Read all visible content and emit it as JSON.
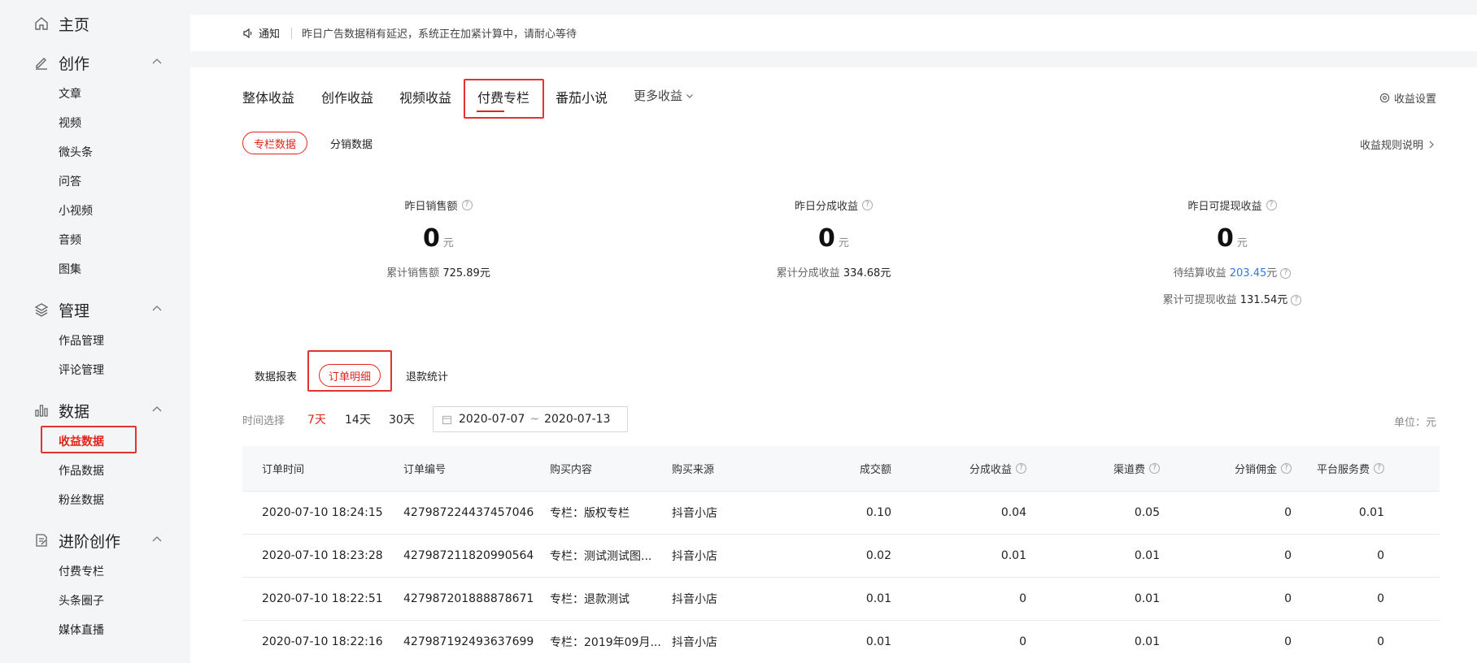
{
  "sidebar": {
    "home": "主页",
    "create": {
      "label": "创作",
      "items": [
        "文章",
        "视频",
        "微头条",
        "问答",
        "小视频",
        "音频",
        "图集"
      ]
    },
    "manage": {
      "label": "管理",
      "items": [
        "作品管理",
        "评论管理"
      ]
    },
    "data": {
      "label": "数据",
      "items": [
        "收益数据",
        "作品数据",
        "粉丝数据"
      ]
    },
    "advanced": {
      "label": "进阶创作",
      "items": [
        "付费专栏",
        "头条圈子",
        "媒体直播"
      ]
    }
  },
  "notice": {
    "label": "通知",
    "text": "昨日广告数据稍有延迟，系统正在加紧计算中，请耐心等待"
  },
  "tabs": [
    "整体收益",
    "创作收益",
    "视频收益",
    "付费专栏",
    "番茄小说",
    "更多收益"
  ],
  "settings_label": "收益设置",
  "subtabs": {
    "column_data": "专栏数据",
    "distribution_data": "分销数据"
  },
  "rules_link": "收益规则说明",
  "stats": {
    "sales": {
      "label": "昨日销售额",
      "value": "0",
      "unit": "元",
      "sub_label": "累计销售额",
      "sub_value": "725.89元"
    },
    "share": {
      "label": "昨日分成收益",
      "value": "0",
      "unit": "元",
      "sub_label": "累计分成收益",
      "sub_value": "334.68元"
    },
    "withdraw": {
      "label": "昨日可提现收益",
      "value": "0",
      "unit": "元",
      "pending_label": "待结算收益",
      "pending_value": "203.45",
      "pending_unit": "元",
      "total_label": "累计可提现收益",
      "total_value": "131.54元"
    }
  },
  "report_tabs": [
    "数据报表",
    "订单明细",
    "退款统计"
  ],
  "time": {
    "label": "时间选择",
    "options": [
      "7天",
      "14天",
      "30天"
    ],
    "start": "2020-07-07",
    "sep": "~",
    "end": "2020-07-13"
  },
  "unit_text": "单位：元",
  "table": {
    "headers": [
      "订单时间",
      "订单编号",
      "购买内容",
      "购买来源",
      "成交额",
      "分成收益",
      "渠道费",
      "分销佣金",
      "平台服务费"
    ],
    "rows": [
      [
        "2020-07-10 18:24:15",
        "427987224437457046",
        "专栏：版权专栏",
        "抖音小店",
        "0.10",
        "0.04",
        "0.05",
        "0",
        "0.01"
      ],
      [
        "2020-07-10 18:23:28",
        "427987211820990564",
        "专栏：测试测试图...",
        "抖音小店",
        "0.02",
        "0.01",
        "0.01",
        "0",
        "0"
      ],
      [
        "2020-07-10 18:22:51",
        "427987201888878671",
        "专栏：退款测试",
        "抖音小店",
        "0.01",
        "0",
        "0.01",
        "0",
        "0"
      ],
      [
        "2020-07-10 18:22:16",
        "427987192493637699",
        "专栏：2019年09月...",
        "抖音小店",
        "0.01",
        "0",
        "0.01",
        "0",
        "0"
      ]
    ]
  },
  "colors": {
    "accent": "#e1251b",
    "highlight_box": "#e23232",
    "link_blue": "#2a7ae2"
  },
  "icons": [
    "home-icon",
    "pencil-icon",
    "layers-icon",
    "bar-chart-icon",
    "document-edit-icon",
    "speaker-icon",
    "gear-icon",
    "calendar-icon",
    "help-icon",
    "chevron-up-icon",
    "chevron-down-icon",
    "chevron-right-icon"
  ]
}
